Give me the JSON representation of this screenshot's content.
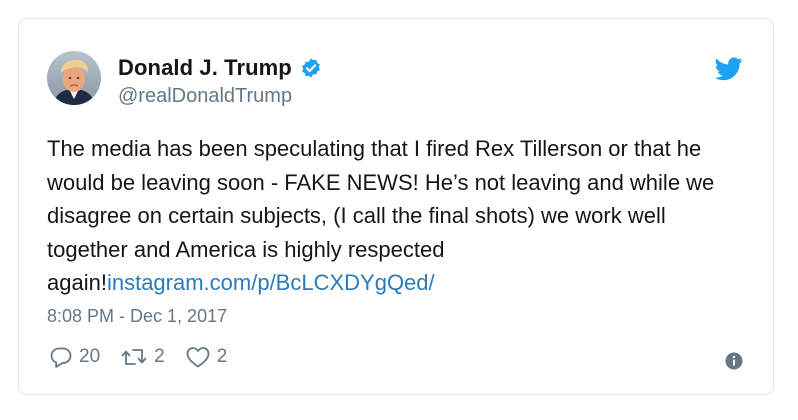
{
  "tweet": {
    "author_name": "Donald J. Trump",
    "handle": "@realDonaldTrump",
    "text": "The media has been speculating that I fired Rex Tillerson or that he would be leaving soon - FAKE NEWS! He’s not leaving and while we disagree on certain subjects, (I call the final shots) we work well together and America is highly respected again!",
    "link_text": "instagram.com/p/BcLCXDYgQed/",
    "timestamp": "8:08 PM - Dec 1, 2017"
  },
  "actions": {
    "replies": "20",
    "retweets": "2",
    "likes": "2"
  },
  "icons": {
    "verified": "verified-badge-icon",
    "brand": "twitter-bird-icon",
    "reply": "reply-icon",
    "retweet": "retweet-icon",
    "like": "heart-icon",
    "info": "info-icon"
  },
  "colors": {
    "twitter_blue": "#1da1f2",
    "link": "#2b7bb9",
    "text": "#14171a",
    "secondary_text": "#657786",
    "border": "#e1e8ed"
  }
}
